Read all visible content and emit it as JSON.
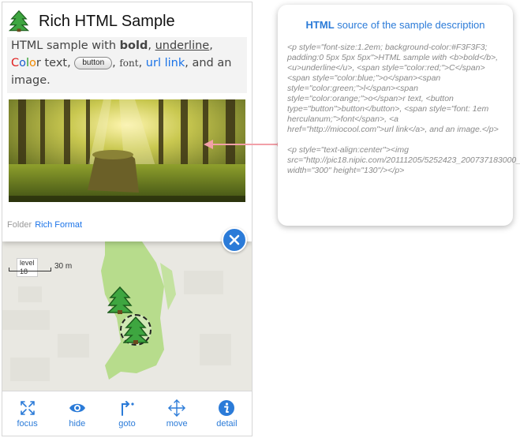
{
  "card": {
    "title": "Rich HTML Sample",
    "desc": {
      "t1": "HTML sample with ",
      "bold": "bold",
      "t2": ", ",
      "underline": "underline",
      "t3": ", ",
      "c1": "C",
      "c2": "o",
      "c3": "l",
      "c4": "o",
      "c5": "r",
      "t4": " text, ",
      "button": "button",
      "t5": ", ",
      "font": "font",
      "t6": ", ",
      "link": "url link",
      "t7": ", and an image."
    },
    "folder_label": "Folder",
    "folder_link": "Rich Format"
  },
  "map": {
    "scale_level": "level 18",
    "scale_distance": "30 m"
  },
  "toolbar": {
    "focus": "focus",
    "hide": "hide",
    "goto": "goto",
    "move": "move",
    "detail": "detail"
  },
  "callout": {
    "title_strong": "HTML",
    "title_rest": " source of the sample description",
    "code": "<p style=\"font-size:1.2em; background-color:#F3F3F3; padding:0 5px 5px 5px\">HTML sample with <b>bold</b>, <u>underline</u>, <span style=\"color:red;\">C</span><span style=\"color:blue;\">o</span><span style=\"color:green;\">l</span><span style=\"color:orange;\">o</span>r text, <button type=\"button\">button</button>, <span style=\"font: 1em herculanum;\">font</span>, <a href=\"http://miocool.com\">url link</a>, and an image.</p>\n\n<p style=\"text-align:center\"><img src=\"http://pic18.nipic.com/20111205/5252423_200737183000_2.jpg\" width=\"300\" height=\"130\"/></p>"
  },
  "colors": {
    "accent": "#2b7bd8",
    "color_c": "#e02020",
    "color_o1": "#1a5fd0",
    "color_l": "#2a9a2a",
    "color_o2": "#f08a00",
    "connector": "#f2a0a8",
    "map_green": "#b7dc8c"
  }
}
